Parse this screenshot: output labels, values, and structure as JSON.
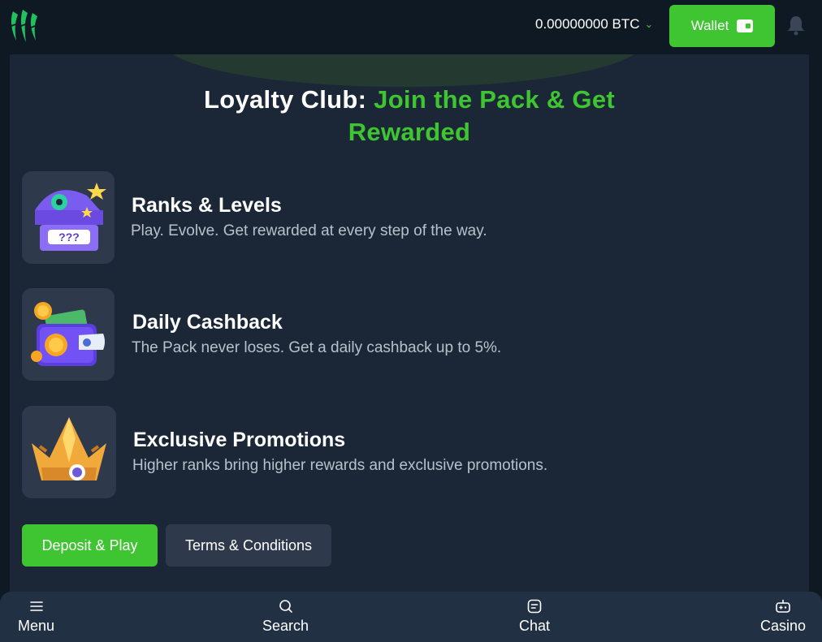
{
  "header": {
    "balance": "0.00000000 BTC",
    "wallet_label": "Wallet"
  },
  "loyalty": {
    "title_white": "Loyalty Club: ",
    "title_green_1": "Join the Pack & Get",
    "title_green_2": "Rewarded",
    "features": [
      {
        "title": "Ranks & Levels",
        "description": "Play. Evolve. Get rewarded at every step of the way.",
        "icon": "treasure-chest-icon"
      },
      {
        "title": "Daily Cashback",
        "description": "The Pack never loses. Get a daily cashback up to 5%.",
        "icon": "cashback-wallet-icon"
      },
      {
        "title": "Exclusive Promotions",
        "description": "Higher ranks bring higher rewards and exclusive promotions.",
        "icon": "crown-icon"
      }
    ],
    "primary_button": "Deposit & Play",
    "secondary_button": "Terms & Conditions"
  },
  "bottom_nav": [
    {
      "label": "Menu",
      "icon": "menu-icon"
    },
    {
      "label": "Search",
      "icon": "search-icon"
    },
    {
      "label": "Chat",
      "icon": "chat-icon"
    },
    {
      "label": "Casino",
      "icon": "casino-icon"
    }
  ],
  "colors": {
    "accent": "#3ec531",
    "background": "#0f1923",
    "panel": "#1b2737",
    "card": "#2e3a4b"
  }
}
